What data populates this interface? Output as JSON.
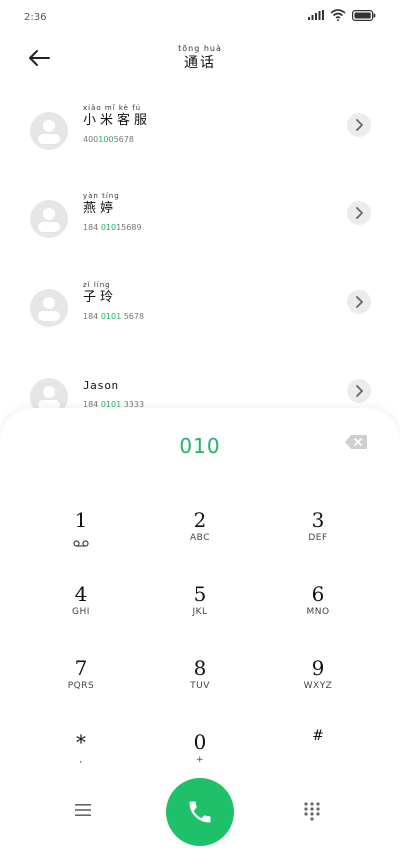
{
  "status": {
    "time": "2:36"
  },
  "header": {
    "title_pinyin": "tōng huà",
    "title": "通话"
  },
  "contacts": [
    {
      "pinyin": "xiǎo mǐ kè fú",
      "name": "小米客服",
      "number_prefix": "400",
      "number_match": "100",
      "number_suffix": "5678"
    },
    {
      "pinyin": "yàn tíng",
      "name": "燕婷",
      "number_prefix": "184 ",
      "number_match": "010",
      "number_suffix": "15689"
    },
    {
      "pinyin": "zǐ líng",
      "name": "子玲",
      "number_prefix": "184 ",
      "number_match": "0101",
      "number_suffix": " 5678"
    },
    {
      "pinyin": "",
      "name": "Jason",
      "number_prefix": "184 ",
      "number_match": "0101",
      "number_suffix": " 3333"
    }
  ],
  "dialpad": {
    "entered": "010",
    "keys": [
      {
        "digit": "1",
        "letters": ""
      },
      {
        "digit": "2",
        "letters": "ABC"
      },
      {
        "digit": "3",
        "letters": "DEF"
      },
      {
        "digit": "4",
        "letters": "GHI"
      },
      {
        "digit": "5",
        "letters": "JKL"
      },
      {
        "digit": "6",
        "letters": "MNO"
      },
      {
        "digit": "7",
        "letters": "PQRS"
      },
      {
        "digit": "8",
        "letters": "TUV"
      },
      {
        "digit": "9",
        "letters": "WXYZ"
      },
      {
        "digit": "*",
        "letters": ","
      },
      {
        "digit": "0",
        "letters": "+"
      },
      {
        "digit": "#",
        "letters": ""
      }
    ]
  },
  "icons": {
    "back": "back-arrow-icon",
    "chevron": "chevron-right-icon",
    "backspace": "backspace-icon",
    "menu": "menu-icon",
    "call": "phone-icon",
    "grid": "dialpad-grid-icon",
    "voicemail": "voicemail-icon"
  },
  "colors": {
    "accent": "#1fb46a",
    "call_button": "#1fc06a",
    "avatar_bg": "#e6e6e6"
  }
}
